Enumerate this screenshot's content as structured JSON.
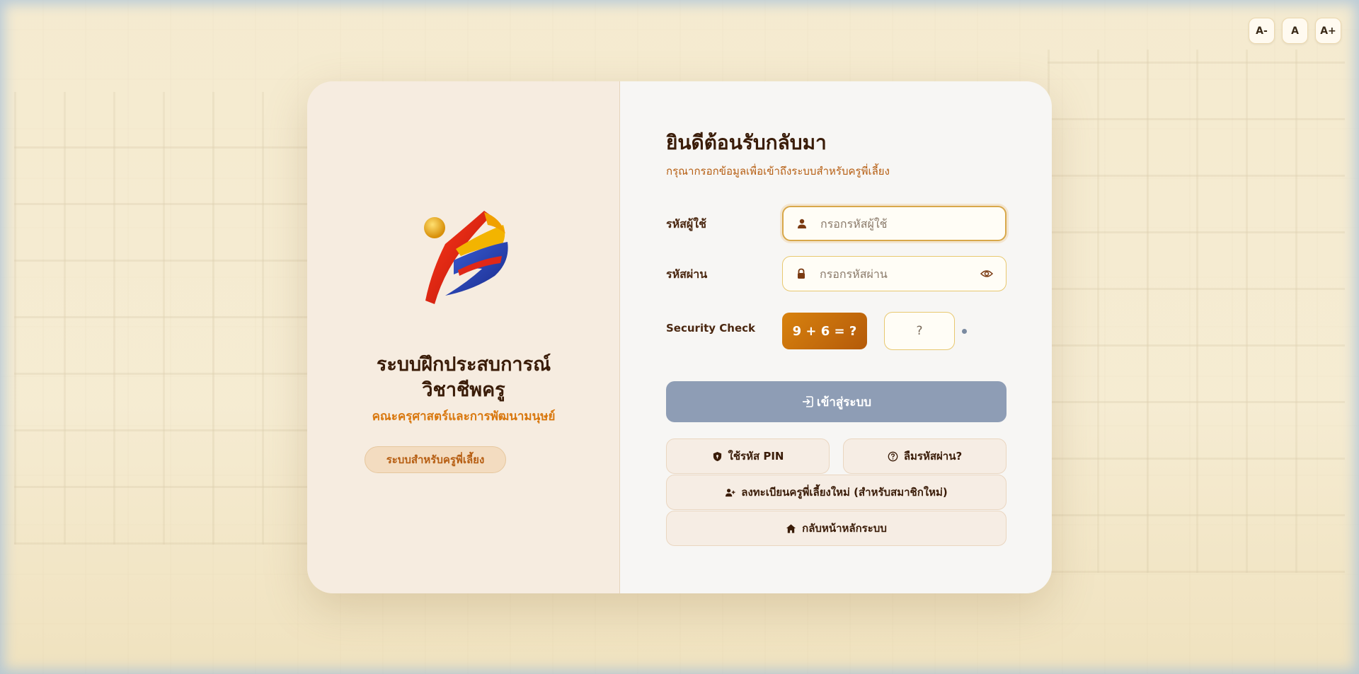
{
  "font_controls": {
    "decrease": "A-",
    "normal": "A",
    "increase": "A+"
  },
  "brand": {
    "system_title_line1": "ระบบฝึกประสบการณ์",
    "system_title_line2": "วิชาชีพครู",
    "faculty": "คณะครุศาสตร์และการพัฒนามนุษย์",
    "role_badge": "ระบบสำหรับครูพี่เลี้ยง"
  },
  "login": {
    "title": "ยินดีต้อนรับกลับมา",
    "subtitle": "กรุณากรอกข้อมูลเพื่อเข้าถึงระบบสำหรับครูพี่เลี้ยง",
    "username_label": "รหัสผู้ใช้",
    "username_placeholder": "กรอกรหัสผู้ใช้",
    "username_value": "",
    "password_label": "รหัสผ่าน",
    "password_placeholder": "กรอกรหัสผ่าน",
    "password_value": "",
    "security_label": "Security Check",
    "captcha_question": "9 + 6 = ?",
    "captcha_placeholder": "?",
    "submit_label": "เข้าสู่ระบบ",
    "pin_label": "ใช้รหัส PIN",
    "forgot_label": "ลืมรหัสผ่าน?",
    "register_label": "ลงทะเบียนครูพี่เลี้ยงใหม่ (สำหรับสมาชิกใหม่)",
    "home_label": "กลับหน้าหลักระบบ"
  },
  "icons": {
    "username": "user-icon",
    "password": "lock-icon",
    "show_password": "eye-icon",
    "submit": "sign-in-icon",
    "pin": "shield-icon",
    "forgot": "question-circle-icon",
    "register": "user-plus-icon",
    "home": "home-icon"
  },
  "colors": {
    "accent": "#d9780f",
    "title": "#3a1c08",
    "submit_disabled": "#8e9db5",
    "input_border": "#e8c870"
  }
}
